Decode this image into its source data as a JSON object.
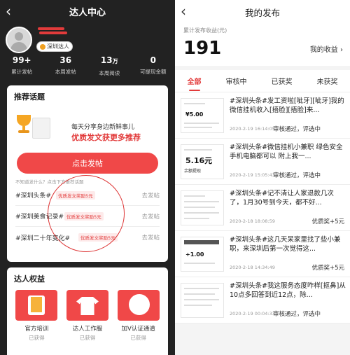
{
  "left": {
    "nav": {
      "back_icon": "chevron-left-icon",
      "title": "达人中心"
    },
    "profile": {
      "badge": "深圳达人"
    },
    "stats": [
      {
        "num": "99+",
        "unit": "",
        "label": "累计发帖"
      },
      {
        "num": "36",
        "unit": "",
        "label": "本周发帖"
      },
      {
        "num": "13",
        "unit": "万",
        "label": "本周阅读"
      },
      {
        "num": "0",
        "unit": "",
        "label": "可提现金额"
      }
    ],
    "recommend": {
      "header": "推荐话题",
      "line1": "每天分享身边新鲜事儿",
      "line2": "优质发文获更多推荐",
      "button": "点击发帖",
      "hint": "不知道发什么？点击下方推荐话题",
      "topics": [
        {
          "name": "#深圳头条#",
          "tag": "优质发文奖励5元",
          "go": "去发帖"
        },
        {
          "name": "#深圳美食记录#",
          "tag": "优质发文奖励5元",
          "go": "去发帖"
        },
        {
          "name": "#深圳二十年变化#",
          "tag": "优质发文奖励5元",
          "go": "去发帖"
        }
      ]
    },
    "rights": {
      "header": "达人权益",
      "items": [
        {
          "label": "官方培训",
          "status": "已获得"
        },
        {
          "label": "达人工作服",
          "status": "已获得"
        },
        {
          "label": "加V认证通道",
          "status": "已获得"
        }
      ]
    }
  },
  "right": {
    "nav": {
      "back_icon": "chevron-left-icon",
      "title": "我的发布"
    },
    "income": {
      "label": "累计发布收益(元)",
      "value": "191",
      "link": "我的收益 ›"
    },
    "tabs": [
      "全部",
      "审核中",
      "已获奖",
      "未获奖"
    ],
    "active_tab": 0,
    "posts": [
      {
        "text": "#深圳头条#发工资啦[呲牙][呲牙]我的微信挂机收入[捂脸][捂脸]来...",
        "date": "2020-2-19 16:14:05",
        "status": "审核通过，评选中",
        "reward": "",
        "thumb_big": "¥5.00"
      },
      {
        "text": "#深圳头条#微信挂机小兼职 绿色安全 手机电脑都可以 附上我一...",
        "date": "2020-2-19 15:05:43",
        "status": "审核通过，评选中",
        "reward": "",
        "thumb_big": "5.16元",
        "thumb_sm": "余额提现"
      },
      {
        "text": "#深圳头条#记不清让人家退款几次了，1月30号到今天，都不好...",
        "date": "2020-2-18 18:08:59",
        "status": "",
        "reward": "优质奖+5元",
        "thumb_big": ""
      },
      {
        "text": "#深圳头条#这几天呆家里找了些小兼职，来深圳后第一次觉得这...",
        "date": "2020-2-18 14:34:49",
        "status": "",
        "reward": "优质奖+5元",
        "thumb_big": "+1.00"
      },
      {
        "text": "#深圳头条#我这服务态度咋样[抠鼻]从10点多回答到近12点，除...",
        "date": "2020-2-19 00:04:33",
        "status": "审核通过，评选中",
        "reward": "",
        "thumb_big": ""
      }
    ]
  },
  "colors": {
    "accent": "#e23b3b",
    "button": "#f04848",
    "dark_bg": "#222222"
  }
}
